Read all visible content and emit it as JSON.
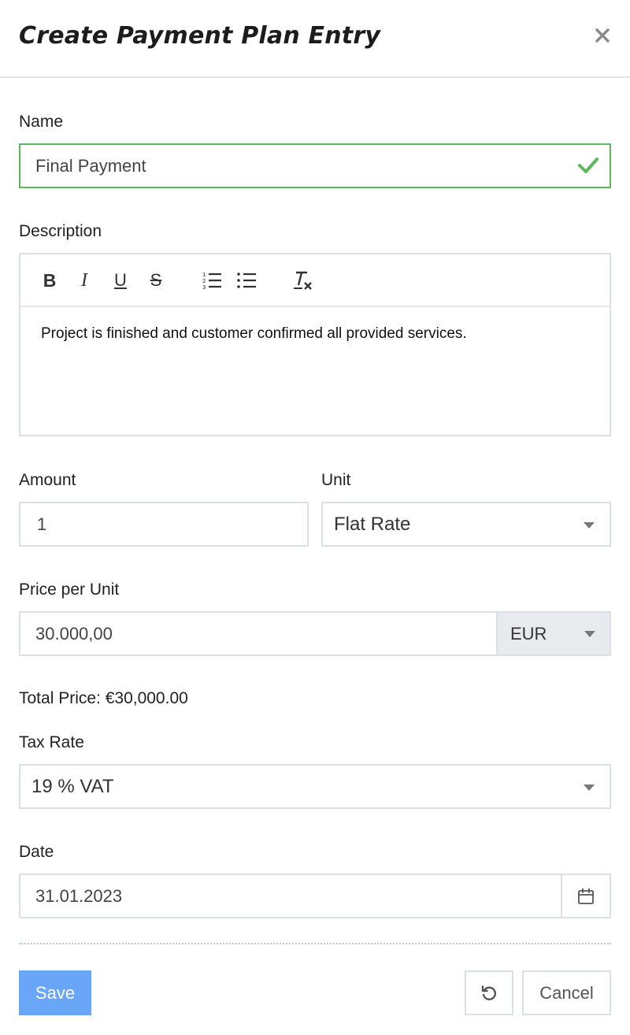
{
  "header": {
    "title": "Create Payment Plan Entry",
    "close_icon": "close-icon"
  },
  "form": {
    "name": {
      "label": "Name",
      "value": "Final Payment",
      "valid": true
    },
    "description": {
      "label": "Description",
      "toolbar": {
        "bold": "B",
        "italic": "I",
        "underline": "U",
        "strikethrough": "S",
        "ordered_list_icon": "ordered-list-icon",
        "bullet_list_icon": "bullet-list-icon",
        "clear_format_icon": "clear-format-icon"
      },
      "value": "Project is finished and customer confirmed all provided services."
    },
    "amount": {
      "label": "Amount",
      "value": "1"
    },
    "unit": {
      "label": "Unit",
      "value": "Flat Rate"
    },
    "price_per_unit": {
      "label": "Price per Unit",
      "value": "30.000,00",
      "currency": "EUR"
    },
    "total_price": "Total Price: €30,000.00",
    "tax_rate": {
      "label": "Tax Rate",
      "value": "19 % VAT"
    },
    "date": {
      "label": "Date",
      "value": "31.01.2023",
      "icon": "calendar-icon"
    }
  },
  "actions": {
    "save_label": "Save",
    "reset_icon": "reset-icon",
    "cancel_label": "Cancel"
  },
  "colors": {
    "valid_border": "#5cb85c",
    "save_button": "#6aa6f8",
    "currency_bg": "#e8ebee"
  }
}
